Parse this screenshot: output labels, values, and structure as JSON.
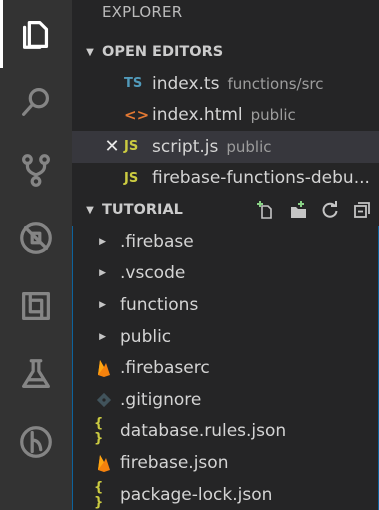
{
  "explorer_title": "EXPLORER",
  "open_editors": {
    "title": "OPEN EDITORS",
    "items": [
      {
        "badge": "TS",
        "name": "index.ts",
        "desc": "functions/src"
      },
      {
        "badge": "<>",
        "name": "index.html",
        "desc": "public"
      },
      {
        "badge": "JS",
        "name": "script.js",
        "desc": "public",
        "close": "✕"
      },
      {
        "badge": "JS",
        "name": "firebase-functions-debu..."
      }
    ]
  },
  "workspace": {
    "title": "TUTORIAL",
    "folders": [
      {
        "name": ".firebase"
      },
      {
        "name": ".vscode"
      },
      {
        "name": "functions"
      },
      {
        "name": "public"
      }
    ],
    "files": [
      {
        "name": ".firebaserc",
        "icon": "firebase-icon"
      },
      {
        "name": ".gitignore",
        "icon": "git-icon"
      },
      {
        "name": "database.rules.json",
        "icon": "json-icon",
        "badge": "{ }"
      },
      {
        "name": "firebase.json",
        "icon": "firebase-icon"
      },
      {
        "name": "package-lock.json",
        "icon": "json-icon",
        "badge": "{ }"
      }
    ]
  },
  "activity_bar": [
    "files-icon",
    "search-icon",
    "source-control-icon",
    "debug-icon",
    "extensions-icon",
    "test-flask-icon",
    "remote-icon"
  ],
  "colors": {
    "ts": "#519aba",
    "js": "#cbcb41",
    "html": "#e37933",
    "firebase": "#f5820d",
    "focus": "#0e639c"
  }
}
